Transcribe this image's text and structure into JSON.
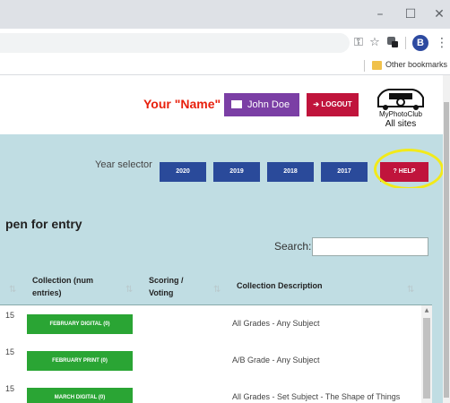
{
  "browser": {
    "window_controls": {
      "minimize": "–",
      "maximize": "☐",
      "close": "✕"
    },
    "toolbar": {
      "profile_initial": "B",
      "key_icon": "key-icon",
      "star_icon": "star-icon",
      "extension_icon": "extension-icon"
    },
    "bookmarks_bar": {
      "other_bookmarks": "Other bookmarks"
    }
  },
  "header": {
    "your_name_label": "Your \"Name\"",
    "user_button": "John Doe",
    "logout_button": "LOGOUT",
    "logo": {
      "name": "MyPhotoClub",
      "subtitle": "All sites"
    }
  },
  "year_selector": {
    "label": "Year selector",
    "years": [
      "2020",
      "2019",
      "2018",
      "2017"
    ],
    "help": "? HELP"
  },
  "main": {
    "title": "pen for entry",
    "search_label": "Search:",
    "search_value": "",
    "columns": [
      "Collection (num entries)",
      "Scoring / Voting",
      "Collection Description"
    ],
    "rows": [
      {
        "num": "15",
        "collection": "FEBRUARY DIGITAL (0)",
        "scoring": "",
        "description": "All Grades - Any Subject"
      },
      {
        "num": "15",
        "collection": "FEBRUARY PRINT (0)",
        "scoring": "",
        "description": "A/B Grade - Any Subject"
      },
      {
        "num": "15",
        "collection": "MARCH DIGITAL (0)",
        "scoring": "",
        "description": "All Grades - Set Subject - The Shape of Things"
      }
    ]
  },
  "colors": {
    "accent_teal": "#c0dde3",
    "user_purple": "#7b3fa5",
    "logout_red": "#c0143c",
    "year_blue": "#2a4a9a",
    "collection_green": "#2aa534",
    "name_red": "#e8200c",
    "highlight_yellow": "#f2ea1a"
  }
}
